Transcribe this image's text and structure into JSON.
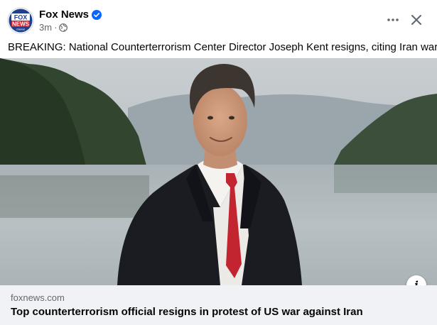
{
  "post": {
    "page_name": "Fox News",
    "timestamp": "3m",
    "separator": "·",
    "verified": true,
    "audience_icon": "globe-icon",
    "text": "BREAKING: National Counterterrorism Center Director Joseph Kent resigns, citing Iran war",
    "avatar_logo": {
      "line1": "FOX",
      "line2": "NEWS",
      "line3": "channel"
    }
  },
  "actions": {
    "more_icon": "more-horizontal-icon",
    "close_icon": "close-icon",
    "info_icon": "info-icon",
    "info_label": "i"
  },
  "link_preview": {
    "domain": "foxnews.com",
    "title": "Top counterterrorism official resigns in protest of US war against Iran"
  },
  "colors": {
    "text_primary": "#050505",
    "text_secondary": "#65676b",
    "verified_blue": "#0866ff",
    "preview_bg": "#f0f2f5",
    "fox_blue": "#1f3f8f",
    "fox_red": "#d0202e"
  }
}
